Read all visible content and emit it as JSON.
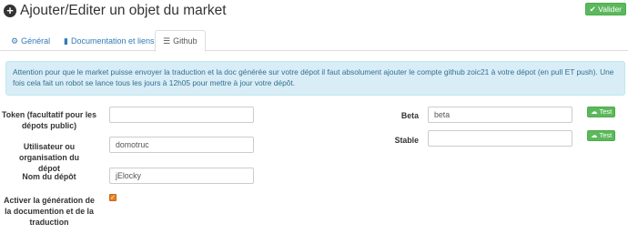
{
  "header": {
    "title": "Ajouter/Editer un objet du market",
    "save_label": "Valider"
  },
  "tabs": [
    {
      "label": "Général",
      "icon": "gear-icon"
    },
    {
      "label": "Documentation et liens",
      "icon": "book-icon"
    },
    {
      "label": "Github",
      "icon": "server-icon",
      "active": true
    }
  ],
  "alert": {
    "text": "Attention pour que le market puisse envoyer la traduction et la doc générée sur votre dépot il faut absolument ajouter le compte github zoic21 à votre dépot (en pull ET push). Une fois cela fait un robot se lance tous les jours à 12h05 pour mettre à jour votre dépôt."
  },
  "form": {
    "token_label": "Token (facultatif pour les dépots public)",
    "token_value": "",
    "user_label": "Utilisateur ou organisation du dépot",
    "user_value": "domotruc",
    "repo_label": "Nom du dépôt",
    "repo_value": "jElocky",
    "translation_label": "Activer la génération de la documention et de la traduction",
    "translation_checked": true,
    "beta_label": "Beta",
    "beta_value": "beta",
    "stable_label": "Stable",
    "stable_value": "",
    "test_label": "Test"
  },
  "colors": {
    "success": "#5cb85c",
    "link": "#337ab7",
    "alert_bg": "#d9edf7",
    "alert_text": "#31708f",
    "checkbox": "#e67e22"
  }
}
